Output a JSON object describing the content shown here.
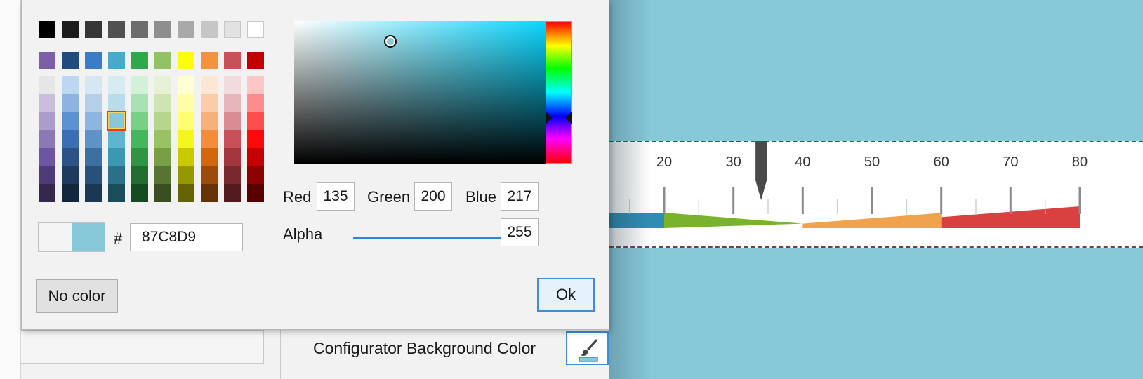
{
  "palette": {
    "base_rows": [
      [
        "#000000",
        "#1c1c1c",
        "#363636",
        "#515151",
        "#6d6d6d",
        "#8e8e8e",
        "#a9a9a9",
        "#c6c6c6",
        "#e2e2e2",
        "#ffffff"
      ],
      [
        "#7d5fa8",
        "#1f4b7f",
        "#3b7cc7",
        "#4aa9ca",
        "#2ea84a",
        "#93c264",
        "#fdfd0a",
        "#f4933d",
        "#c85058",
        "#c00000"
      ]
    ],
    "tint_columns": [
      [
        "#e6e6e6",
        "#c9bfdc",
        "#ab9ccc",
        "#8d78b6",
        "#6d56a1",
        "#4d3c78",
        "#34284f"
      ],
      [
        "#bcd7ef",
        "#8db3e0",
        "#5c91d2",
        "#3b6eb5",
        "#2b5386",
        "#1d3a5f",
        "#12263e"
      ],
      [
        "#d7e6f3",
        "#b6d0ea",
        "#8db5dd",
        "#5f92c6",
        "#3c6fa2",
        "#29507a",
        "#1c3754"
      ],
      [
        "#d7ebf2",
        "#b9dcea",
        "#87c8d9",
        "#5db5cf",
        "#3a98b3",
        "#2a7188",
        "#1c4d5d"
      ],
      [
        "#d3f0d8",
        "#a8e2b2",
        "#78d087",
        "#44b65c",
        "#2f9443",
        "#226e31",
        "#164a21"
      ],
      [
        "#e6f1d5",
        "#cfe4b3",
        "#b5d48c",
        "#98c264",
        "#789f45",
        "#577432",
        "#3a4e21"
      ],
      [
        "#ffffd1",
        "#ffffa3",
        "#ffff70",
        "#f5f51f",
        "#c9c900",
        "#979700",
        "#636300"
      ],
      [
        "#fde6d3",
        "#facda8",
        "#f7b079",
        "#f48c3a",
        "#d4660e",
        "#9c4b0a",
        "#673106"
      ],
      [
        "#f2dbdd",
        "#e6b6ba",
        "#d88c93",
        "#c85058",
        "#a3363e",
        "#79282e",
        "#511b1f"
      ],
      [
        "#ffc6c6",
        "#ff8c8c",
        "#ff4d4d",
        "#ff0a0a",
        "#c60000",
        "#8c0000",
        "#590000"
      ]
    ],
    "selected": {
      "column": 3,
      "row": 2
    }
  },
  "current_color": {
    "hex": "87C8D9",
    "swatch_hex": "#87c8d9",
    "hash_label": "#"
  },
  "rgb": {
    "red_label": "Red",
    "red_value": "135",
    "green_label": "Green",
    "green_value": "200",
    "blue_label": "Blue",
    "blue_value": "217"
  },
  "alpha": {
    "label": "Alpha",
    "value": "255",
    "fraction": 1.0
  },
  "buttons": {
    "no_color": "No color",
    "ok": "Ok"
  },
  "configurator": {
    "label": "Configurator Background Color",
    "button_icon": "brush-icon"
  },
  "preview": {
    "background_color": "#87c8d9",
    "gauge": {
      "scale_min": 20,
      "scale_max": 80,
      "tick_labels": [
        "20",
        "30",
        "40",
        "50",
        "60",
        "70",
        "80"
      ],
      "pointer_value": 34,
      "ranges": [
        {
          "from": 20,
          "to": 40,
          "color": "#79b32b"
        },
        {
          "from": 40,
          "to": 60,
          "color": "#f0a34c"
        },
        {
          "from": 60,
          "to": 80,
          "color": "#d84140"
        }
      ],
      "lead_color": "#2f8db4"
    }
  }
}
